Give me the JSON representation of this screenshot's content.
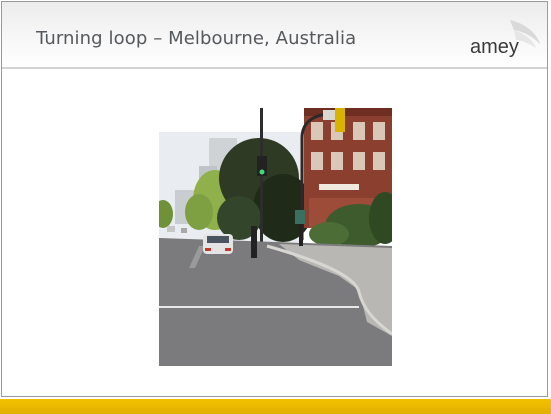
{
  "slide": {
    "title": "Turning loop – Melbourne, Australia",
    "logo_text": "amey"
  },
  "photo": {
    "subject": "photo-street-turning-loop"
  },
  "colors": {
    "title": "#55585c",
    "footer_band": "#e8b800",
    "logo_text": "#3b3b3b",
    "logo_swoosh": "#cfcfcf"
  }
}
